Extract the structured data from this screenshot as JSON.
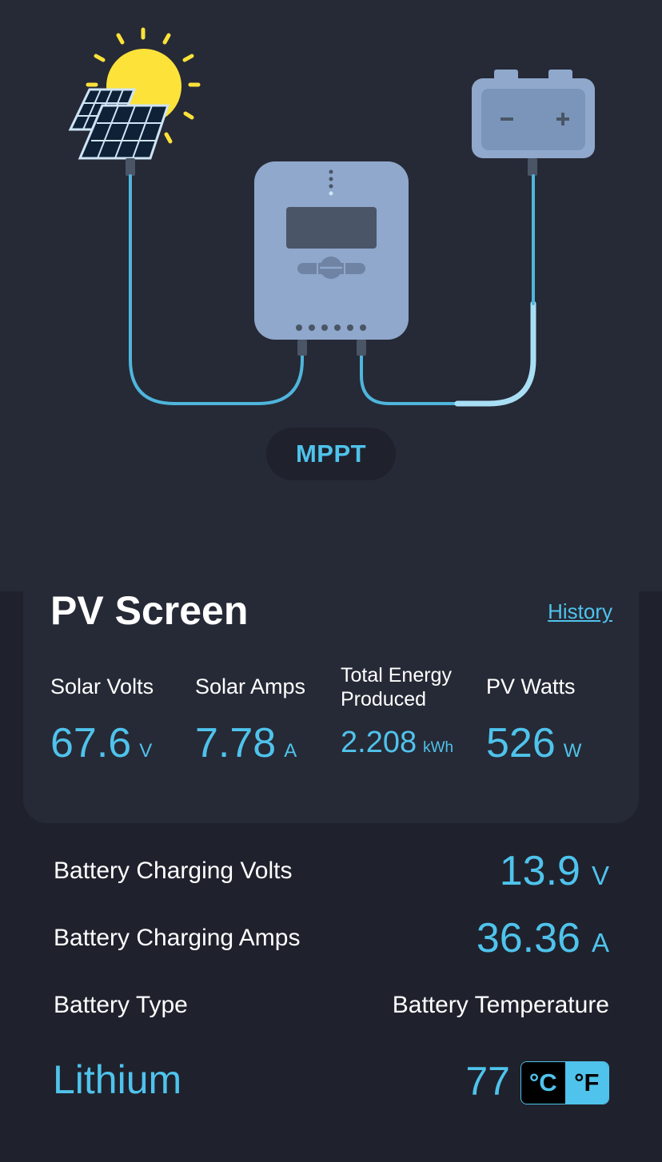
{
  "diagram": {
    "controller_label": "MPPT",
    "battery_minus": "−",
    "battery_plus": "+"
  },
  "pv_screen": {
    "title": "PV Screen",
    "history_link": "History",
    "metrics": [
      {
        "label": "Solar Volts",
        "value": "67.6",
        "unit": "V"
      },
      {
        "label": "Solar Amps",
        "value": "7.78",
        "unit": "A"
      },
      {
        "label": "Total Energy Produced",
        "value": "2.208",
        "unit": "kWh"
      },
      {
        "label": "PV Watts",
        "value": "526",
        "unit": "W"
      }
    ]
  },
  "battery": {
    "charging_volts": {
      "label": "Battery Charging Volts",
      "value": "13.9",
      "unit": "V"
    },
    "charging_amps": {
      "label": "Battery Charging Amps",
      "value": "36.36",
      "unit": "A"
    },
    "type_label": "Battery Type",
    "type_value": "Lithium",
    "temperature_label": "Battery Temperature",
    "temperature_value": "77",
    "temperature_units": {
      "celsius": "°C",
      "fahrenheit": "°F",
      "selected": "°F"
    }
  },
  "colors": {
    "accent": "#4fc3ec",
    "background": "#1f222d",
    "card": "#262a36",
    "device": "#8fa8cc"
  }
}
